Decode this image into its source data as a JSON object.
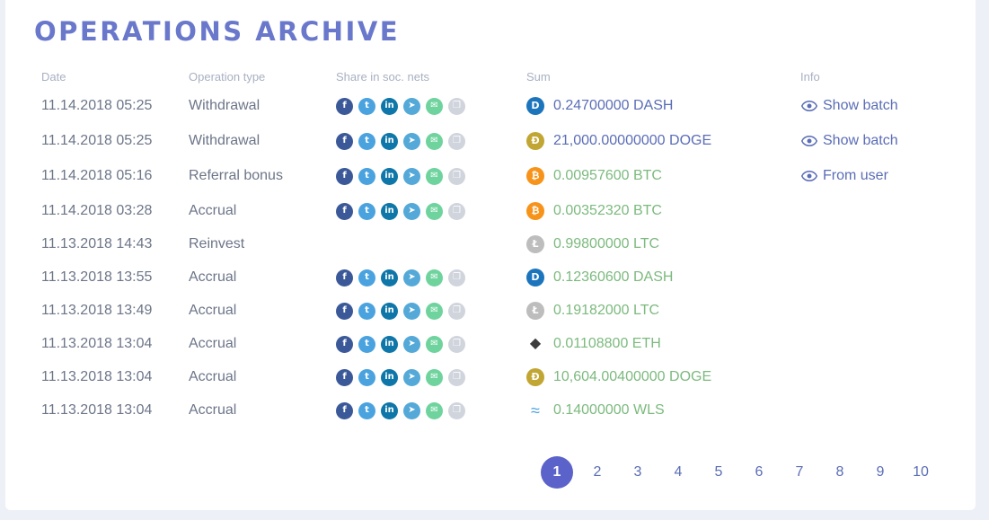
{
  "title": "OPERATIONS ARCHIVE",
  "headers": {
    "date": "Date",
    "type": "Operation type",
    "share": "Share in soc. nets",
    "sum": "Sum",
    "info": "Info"
  },
  "share_icons": [
    {
      "name": "facebook",
      "glyph": "f",
      "color": "#3b5998"
    },
    {
      "name": "twitter",
      "glyph": "t",
      "color": "#4aa3df"
    },
    {
      "name": "linkedin",
      "glyph": "in",
      "color": "#0e76a8"
    },
    {
      "name": "telegram",
      "glyph": "➤",
      "color": "#54a9d8"
    },
    {
      "name": "email",
      "glyph": "✉",
      "color": "#6fd39e"
    },
    {
      "name": "copy",
      "glyph": "❐",
      "color": "#d0d4dc"
    }
  ],
  "coins": {
    "DASH": {
      "color": "#1c75bc",
      "glyph": "D"
    },
    "DOGE": {
      "color": "#c2a633",
      "glyph": "Ð"
    },
    "BTC": {
      "color": "#f7931a",
      "glyph": "₿"
    },
    "LTC": {
      "color": "#bdbdbd",
      "glyph": "Ł"
    },
    "ETH": {
      "color": "#3c3c3d",
      "glyph": "◆"
    },
    "WLS": {
      "color": "#4aa3df",
      "glyph": "≈"
    }
  },
  "operations": [
    {
      "date": "11.14.2018 05:25",
      "type": "Withdrawal",
      "share": true,
      "coin": "DASH",
      "sum": "0.24700000 DASH",
      "sum_style": "blue",
      "info": "Show batch"
    },
    {
      "date": "11.14.2018 05:25",
      "type": "Withdrawal",
      "share": true,
      "coin": "DOGE",
      "sum": "21,000.00000000 DOGE",
      "sum_style": "blue",
      "info": "Show batch"
    },
    {
      "date": "11.14.2018 05:16",
      "type": "Referral bonus",
      "share": true,
      "coin": "BTC",
      "sum": "0.00957600 BTC",
      "sum_style": "green",
      "info": "From user"
    },
    {
      "date": "11.14.2018 03:28",
      "type": "Accrual",
      "share": true,
      "coin": "BTC",
      "sum": "0.00352320 BTC",
      "sum_style": "green",
      "info": ""
    },
    {
      "date": "11.13.2018 14:43",
      "type": "Reinvest",
      "share": false,
      "coin": "LTC",
      "sum": "0.99800000 LTC",
      "sum_style": "green",
      "info": ""
    },
    {
      "date": "11.13.2018 13:55",
      "type": "Accrual",
      "share": true,
      "coin": "DASH",
      "sum": "0.12360600 DASH",
      "sum_style": "green",
      "info": ""
    },
    {
      "date": "11.13.2018 13:49",
      "type": "Accrual",
      "share": true,
      "coin": "LTC",
      "sum": "0.19182000 LTC",
      "sum_style": "green",
      "info": ""
    },
    {
      "date": "11.13.2018 13:04",
      "type": "Accrual",
      "share": true,
      "coin": "ETH",
      "sum": "0.01108800 ETH",
      "sum_style": "green",
      "info": ""
    },
    {
      "date": "11.13.2018 13:04",
      "type": "Accrual",
      "share": true,
      "coin": "DOGE",
      "sum": "10,604.00400000 DOGE",
      "sum_style": "green",
      "info": ""
    },
    {
      "date": "11.13.2018 13:04",
      "type": "Accrual",
      "share": true,
      "coin": "WLS",
      "sum": "0.14000000 WLS",
      "sum_style": "green",
      "info": ""
    }
  ],
  "pagination": {
    "pages": [
      "1",
      "2",
      "3",
      "4",
      "5",
      "6",
      "7",
      "8",
      "9",
      "10"
    ],
    "current": "1"
  }
}
